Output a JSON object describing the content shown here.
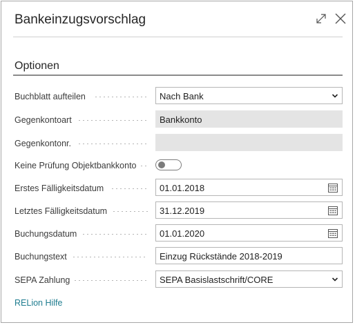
{
  "dialog": {
    "title": "Bankeinzugsvorschlag",
    "expand_icon": "expand-icon",
    "close_icon": "close-icon"
  },
  "section": {
    "title": "Optionen"
  },
  "fields": [
    {
      "label": "Buchblatt aufteilen",
      "value": "Nach Bank",
      "type": "select"
    },
    {
      "label": "Gegenkontoart",
      "value": "Bankkonto",
      "type": "readonly"
    },
    {
      "label": "Gegenkontonr.",
      "value": "",
      "type": "readonly"
    },
    {
      "label": "Keine Prüfung Objektbankkonto",
      "value": "off",
      "type": "toggle"
    },
    {
      "label": "Erstes Fälligkeitsdatum",
      "value": "01.01.2018",
      "type": "date"
    },
    {
      "label": "Letztes Fälligkeitsdatum",
      "value": "31.12.2019",
      "type": "date"
    },
    {
      "label": "Buchungsdatum",
      "value": "01.01.2020",
      "type": "date"
    },
    {
      "label": "Buchungstext",
      "value": "Einzug Rückstände 2018-2019",
      "type": "text"
    },
    {
      "label": "SEPA Zahlung",
      "value": "SEPA Basislastschrift/CORE",
      "type": "select"
    }
  ],
  "help_link": "RELion Hilfe",
  "colors": {
    "link": "#1e7c8f",
    "readonly_bg": "#e4e4e4",
    "border": "#b5b5b5"
  }
}
